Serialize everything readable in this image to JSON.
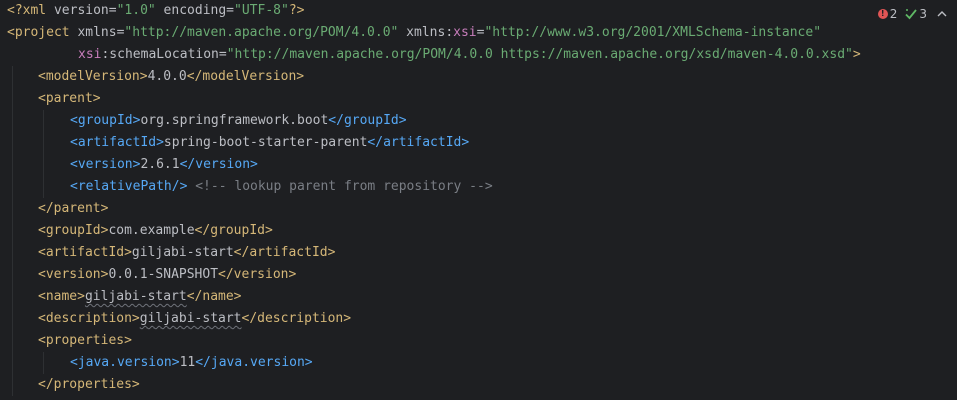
{
  "xml_decl": {
    "open": "<?xml",
    "version_attr": " version=",
    "version_value": "\"1.0\"",
    "encoding_attr": " encoding=",
    "encoding_value": "\"UTF-8\"",
    "close": "?>"
  },
  "project": {
    "open": "<project",
    "xmlns_attr": " xmlns=",
    "xmlns_value": "\"http://maven.apache.org/POM/4.0.0\"",
    "xmlns_xsi_attr": " xmlns:",
    "xmlns_xsi_ns": "xsi",
    "eq": "=",
    "xmlns_xsi_value": "\"http://www.w3.org/2001/XMLSchema-instance\"",
    "schema_ns": "xsi",
    "schema_attr": ":schemaLocation=",
    "schema_value": "\"http://maven.apache.org/POM/4.0.0 https://maven.apache.org/xsd/maven-4.0.0.xsd\"",
    "close": ">"
  },
  "model_version": {
    "open": "<modelVersion>",
    "value": "4.0.0",
    "close": "</modelVersion>"
  },
  "parent": {
    "open": "<parent>",
    "group_open": "<groupId>",
    "group_value": "org.springframework.boot",
    "group_close": "</groupId>",
    "artifact_open": "<artifactId>",
    "artifact_value": "spring-boot-starter-parent",
    "artifact_close": "</artifactId>",
    "version_open": "<version>",
    "version_value": "2.6.1",
    "version_close": "</version>",
    "relative_path": "<relativePath/>",
    "comment": " <!-- lookup parent from repository -->",
    "close": "</parent>"
  },
  "group": {
    "open": "<groupId>",
    "value": "com.example",
    "close": "</groupId>"
  },
  "artifact": {
    "open": "<artifactId>",
    "value": "giljabi-start",
    "close": "</artifactId>"
  },
  "version": {
    "open": "<version>",
    "value": "0.0.1-SNAPSHOT",
    "close": "</version>"
  },
  "name": {
    "open": "<name>",
    "value": "giljabi-start",
    "close": "</name>"
  },
  "description": {
    "open": "<description>",
    "value": "giljabi-start",
    "close": "</description>"
  },
  "properties": {
    "open": "<properties>",
    "java_open": "<java.version>",
    "java_value": "11",
    "java_close": "</java.version>",
    "close": "</properties>"
  },
  "inspections": {
    "errors": "2",
    "warnings": "3",
    "error_color": "#e05555",
    "warning_color": "#5fb865",
    "error_icon": "error-icon",
    "warning_icon": "check-icon",
    "toggle_icon": "chevron-up-icon"
  }
}
